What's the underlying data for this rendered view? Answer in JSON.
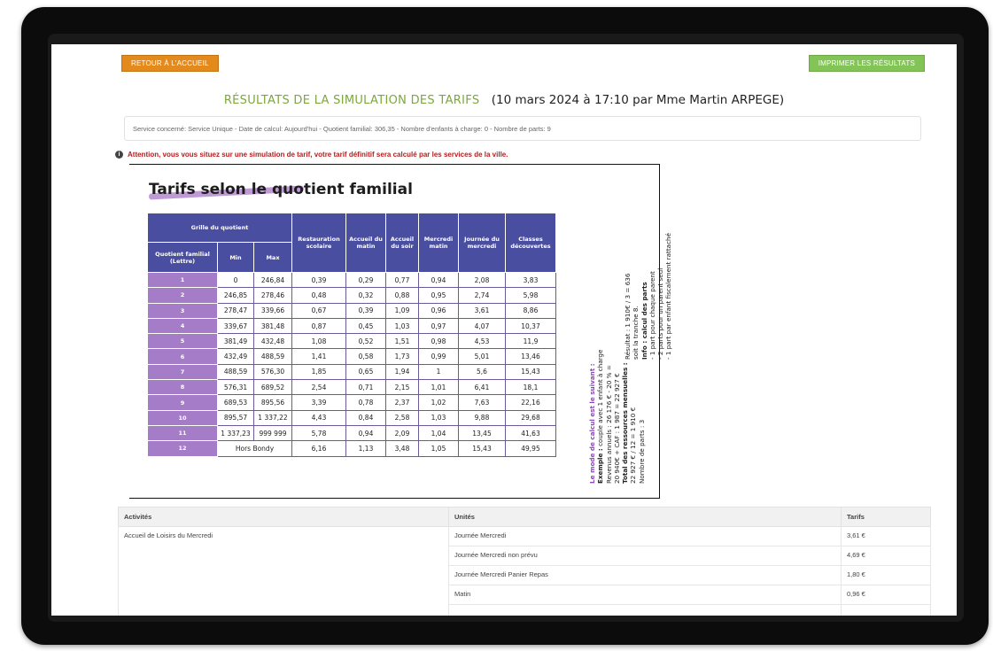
{
  "buttons": {
    "back": "Retour à l'accueil",
    "print": "Imprimer les résultats"
  },
  "header": {
    "title": "RÉSULTATS DE LA SIMULATION DES TARIFS",
    "subtitle": "(10 mars 2024 à 17:10 par Mme Martin ARPEGE)"
  },
  "service_info": "Service concerné: Service Unique - Date de calcul: Aujourd'hui - Quotient familial: 306,35 - Nombre d'enfants à charge: 0 - Nombre de parts: 9",
  "warning": "Attention, vous vous situez sur une simulation de tarif, votre tarif définitif sera calculé par les services de la ville.",
  "document": {
    "title": "Tarifs selon le quotient familial",
    "table_headers": {
      "grille": "Grille du quotient",
      "qf": "Quotient familial (Lettre)",
      "min": "Min",
      "max": "Max",
      "restauration": "Restauration scolaire",
      "accueil_matin": "Accueil du matin",
      "accueil_soir": "Accueil du soir",
      "mercredi_matin": "Mercredi matin",
      "journee_mercredi": "Journée du mercredi",
      "classes": "Classes découvertes"
    },
    "rows": [
      [
        "1",
        "0",
        "246,84",
        "0,39",
        "0,29",
        "0,77",
        "0,94",
        "2,08",
        "3,83"
      ],
      [
        "2",
        "246,85",
        "278,46",
        "0,48",
        "0,32",
        "0,88",
        "0,95",
        "2,74",
        "5,98"
      ],
      [
        "3",
        "278,47",
        "339,66",
        "0,67",
        "0,39",
        "1,09",
        "0,96",
        "3,61",
        "8,86"
      ],
      [
        "4",
        "339,67",
        "381,48",
        "0,87",
        "0,45",
        "1,03",
        "0,97",
        "4,07",
        "10,37"
      ],
      [
        "5",
        "381,49",
        "432,48",
        "1,08",
        "0,52",
        "1,51",
        "0,98",
        "4,53",
        "11,9"
      ],
      [
        "6",
        "432,49",
        "488,59",
        "1,41",
        "0,58",
        "1,73",
        "0,99",
        "5,01",
        "13,46"
      ],
      [
        "7",
        "488,59",
        "576,30",
        "1,85",
        "0,65",
        "1,94",
        "1",
        "5,6",
        "15,43"
      ],
      [
        "8",
        "576,31",
        "689,52",
        "2,54",
        "0,71",
        "2,15",
        "1,01",
        "6,41",
        "18,1"
      ],
      [
        "9",
        "689,53",
        "895,56",
        "3,39",
        "0,78",
        "2,37",
        "1,02",
        "7,63",
        "22,16"
      ],
      [
        "10",
        "895,57",
        "1 337,22",
        "4,43",
        "0,84",
        "2,58",
        "1,03",
        "9,88",
        "29,68"
      ],
      [
        "11",
        "1 337,23",
        "999 999",
        "5,78",
        "0,94",
        "2,09",
        "1,04",
        "13,45",
        "41,63"
      ]
    ],
    "last_row": {
      "qf": "12",
      "range": "Hors Bondy",
      "values": [
        "6,16",
        "1,13",
        "3,48",
        "1,05",
        "15,43",
        "49,95"
      ]
    },
    "side_note": {
      "heading": "Le mode de calcul est le suivant :",
      "example_label": "Exemple :",
      "example": "couple avec 1 enfant à charge",
      "line1": "Revenus annuels : 26 176 € - 20 % =",
      "line2": "20 940€ + CAF : 1 987 = 22 927 €",
      "total_label": "Total des ressources mensuelles :",
      "line3": "22 927 € / 12 = 1 910 €",
      "line4": "Nombre de parts : 3",
      "line5": "Résultat : 1 910€ / 3 = 636",
      "line6": "soit la tranche 8.",
      "info_label": "Info : calcul des parts",
      "info1": "- 1 part pour chaque parent",
      "info2": "- 2 parts pour un parent seul",
      "info3": "- 1 part par enfant fiscalement rattaché"
    }
  },
  "activities": {
    "headers": [
      "Activités",
      "Unités",
      "Tarifs"
    ],
    "activity": "Accueil de Loisirs du Mercredi",
    "rows": [
      {
        "unit": "Journée Mercredi",
        "price": "3,61 €"
      },
      {
        "unit": "Journée Mercredi non prévu",
        "price": "4,69 €"
      },
      {
        "unit": "Journée Mercredi Panier Repas",
        "price": "1,80 €"
      },
      {
        "unit": "Matin",
        "price": "0,96 €"
      }
    ]
  },
  "colors": {
    "back_button": "#e48a1c",
    "print_button": "#82c455",
    "title_green": "#7da73c",
    "warning_red": "#b81c1c",
    "table_header": "#4a4ea0",
    "qf_column": "#a57cc8"
  }
}
